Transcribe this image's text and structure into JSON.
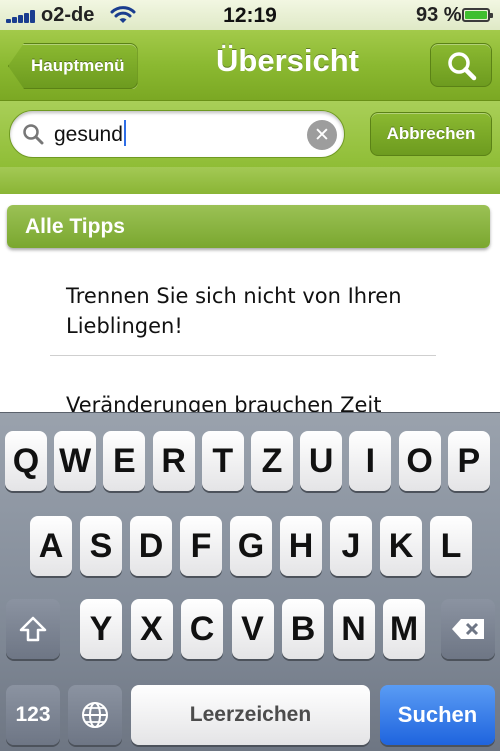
{
  "status_bar": {
    "carrier": "o2-de",
    "time": "12:19",
    "battery_percent": "93 %",
    "battery_level": 0.93
  },
  "nav": {
    "back_label": "Hauptmenü",
    "title": "Übersicht",
    "search_icon": "search-icon"
  },
  "search": {
    "query": "gesund",
    "cancel_label": "Abbrechen"
  },
  "content": {
    "section_header": "Alle Tipps",
    "items": [
      {
        "text": "Trennen Sie sich nicht von Ihren Lieblingen!"
      },
      {
        "text": "Veränderungen brauchen Zeit"
      }
    ]
  },
  "keyboard": {
    "row1": [
      "Q",
      "W",
      "E",
      "R",
      "T",
      "Z",
      "U",
      "I",
      "O",
      "P"
    ],
    "row2": [
      "A",
      "S",
      "D",
      "F",
      "G",
      "H",
      "J",
      "K",
      "L"
    ],
    "row3": [
      "Y",
      "X",
      "C",
      "V",
      "B",
      "N",
      "M"
    ],
    "numbers_label": "123",
    "space_label": "Leerzeichen",
    "return_label": "Suchen",
    "shift_icon": "shift-icon",
    "globe_icon": "globe-icon",
    "delete_icon": "delete-icon"
  },
  "colors": {
    "accent_green": "#8bb931",
    "search_key_blue": "#1f64de"
  }
}
